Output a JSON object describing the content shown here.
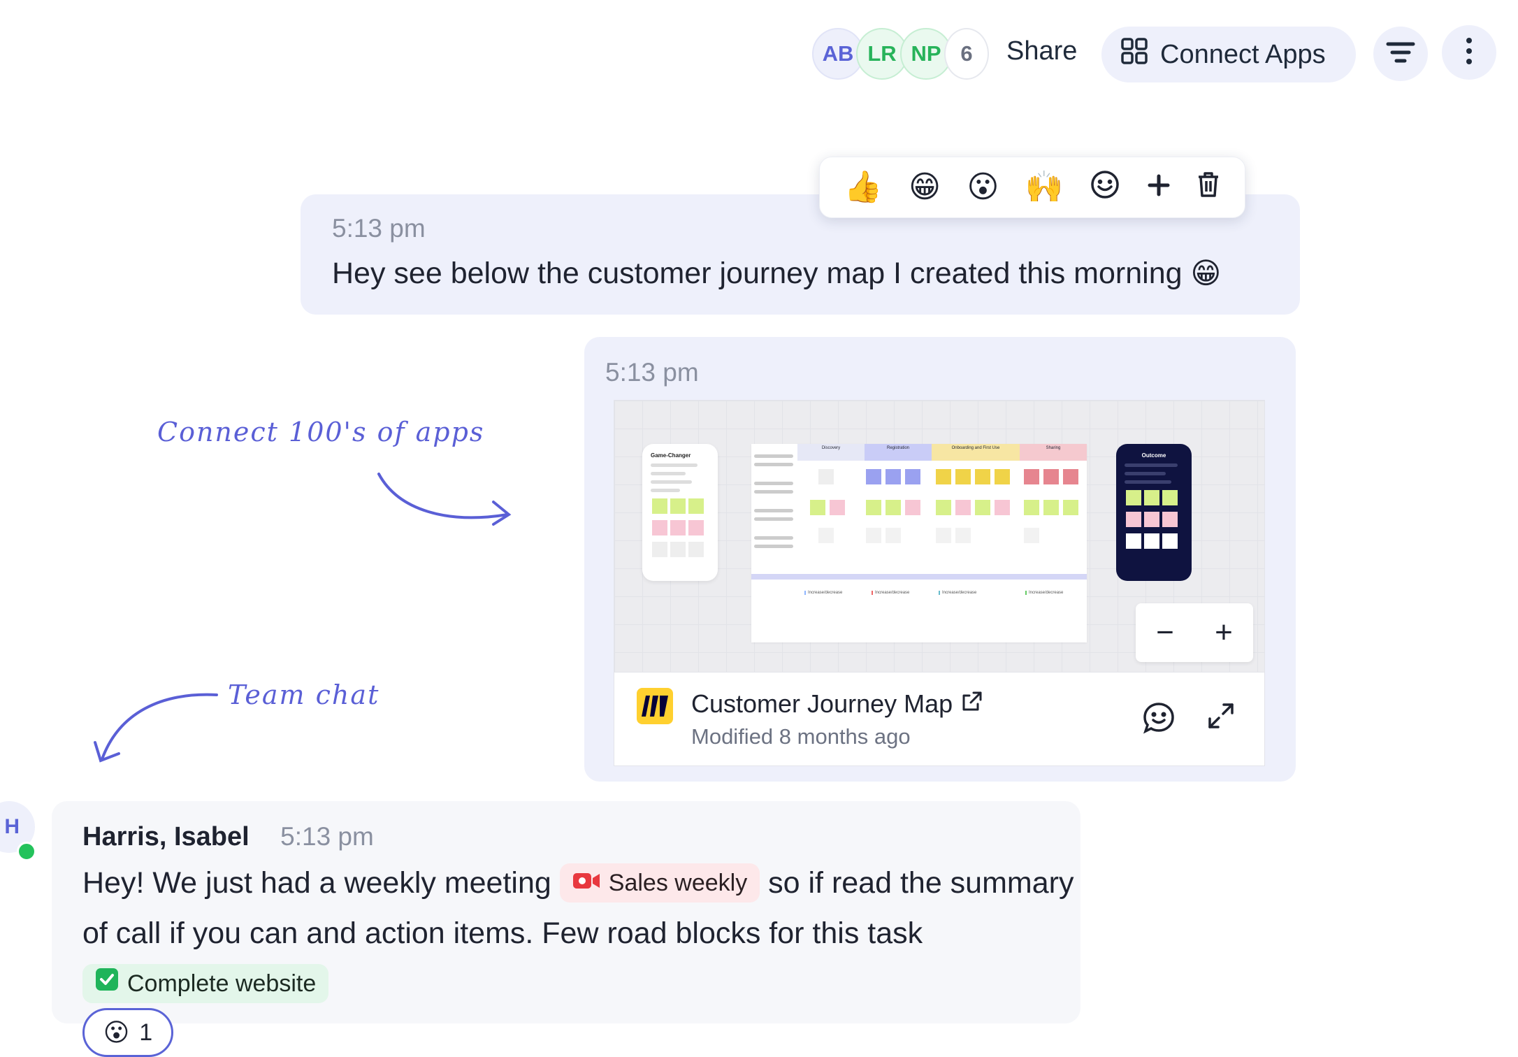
{
  "header": {
    "participants": [
      {
        "initials": "AB",
        "color": "#5a63d6"
      },
      {
        "initials": "LR",
        "color": "#27b35a"
      },
      {
        "initials": "NP",
        "color": "#27b35a"
      }
    ],
    "participant_overflow": "6",
    "share_label": "Share",
    "connect_apps_label": "Connect Apps",
    "connect_apps_icon": "grid-icon",
    "filter_icon": "filter-icon",
    "more_icon": "kebab-menu-icon"
  },
  "reaction_bar": {
    "emojis": [
      "👍",
      "😁",
      "😮",
      "🙌",
      "smiley-outline-icon"
    ],
    "add_icon": "plus-icon",
    "delete_icon": "trash-icon"
  },
  "message1": {
    "time": "5:13 pm",
    "text": "Hey see below the customer journey map I created this morning",
    "emoji": "😁"
  },
  "message2": {
    "time": "5:13 pm",
    "board": {
      "left_phone_title": "Game-Changer",
      "right_phone_title": "Outcome",
      "columns": [
        "Discovery",
        "Registration",
        "Onboarding and First Use",
        "Sharing"
      ],
      "column_colors": [
        "#d9dcf3",
        "#c9ccf7",
        "#f7e6a3",
        "#f5c9cf"
      ],
      "cell_label": "Increase/decrease",
      "zoom_out_label": "−",
      "zoom_in_label": "+"
    },
    "file": {
      "title": "Customer Journey Map",
      "subtitle": "Modified 8 months ago",
      "app_icon": "miro-logo-icon",
      "external_icon": "external-link-icon",
      "comment_icon": "comment-smiley-icon",
      "expand_icon": "expand-icon"
    }
  },
  "annotations": {
    "apps": "Connect 100's of apps",
    "chat": "Team chat"
  },
  "message3": {
    "avatar_initial": "H",
    "sender": "Harris, Isabel",
    "time": "5:13 pm",
    "text_before_meeting": "Hey! We just had a weekly meeting",
    "meeting_chip": "Sales weekly",
    "text_after_meeting": "so if read the summary of call if you can and action items. Few road blocks for this task",
    "task_chip": "Complete website",
    "reaction_emoji": "😮",
    "reaction_count": "1"
  },
  "colors": {
    "accent": "#5a63d6",
    "bubble_bg": "#eef0fb",
    "online": "#23c25b",
    "meeting_red": "#e8383f",
    "task_green": "#1fb45a"
  }
}
